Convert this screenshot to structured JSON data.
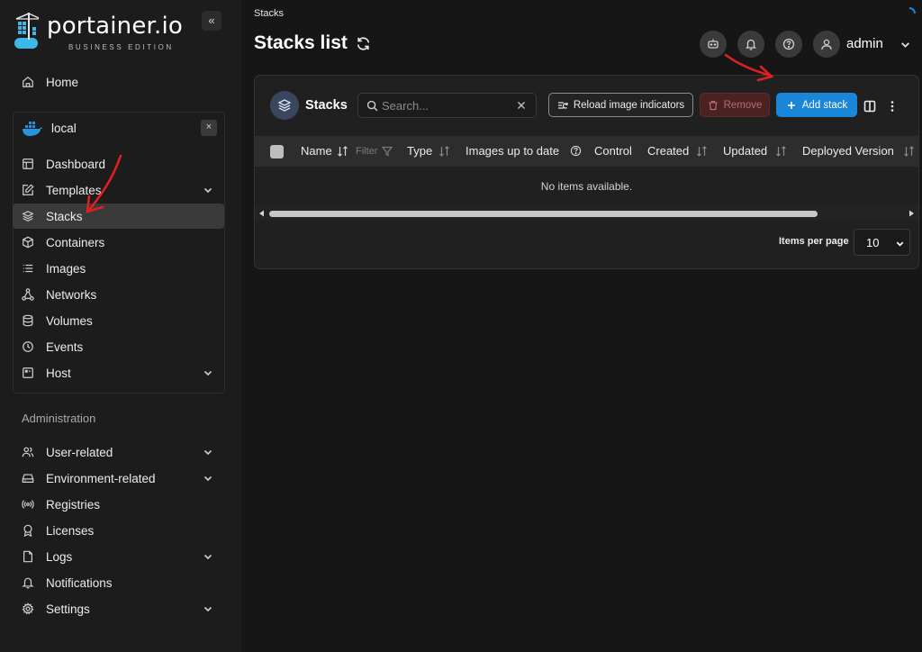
{
  "brand": {
    "name": "portainer.io",
    "edition": "BUSINESS EDITION"
  },
  "sidebar": {
    "collapse_label": "«",
    "home": "Home",
    "environment": {
      "name": "local",
      "close_label": "×"
    },
    "env_items": [
      {
        "label": "Dashboard",
        "icon": "dashboard-icon"
      },
      {
        "label": "Templates",
        "icon": "edit-icon",
        "expandable": true
      },
      {
        "label": "Stacks",
        "icon": "layers-icon",
        "active": true
      },
      {
        "label": "Containers",
        "icon": "box-icon"
      },
      {
        "label": "Images",
        "icon": "list-icon"
      },
      {
        "label": "Networks",
        "icon": "network-icon"
      },
      {
        "label": "Volumes",
        "icon": "database-icon"
      },
      {
        "label": "Events",
        "icon": "clock-icon"
      },
      {
        "label": "Host",
        "icon": "host-icon",
        "expandable": true
      }
    ],
    "admin_section_label": "Administration",
    "admin_items": [
      {
        "label": "User-related",
        "icon": "users-icon",
        "expandable": true
      },
      {
        "label": "Environment-related",
        "icon": "drive-icon",
        "expandable": true
      },
      {
        "label": "Registries",
        "icon": "broadcast-icon"
      },
      {
        "label": "Licenses",
        "icon": "award-icon"
      },
      {
        "label": "Logs",
        "icon": "file-icon",
        "expandable": true
      },
      {
        "label": "Notifications",
        "icon": "bell-icon"
      },
      {
        "label": "Settings",
        "icon": "settings-icon",
        "expandable": true
      }
    ]
  },
  "header": {
    "breadcrumb": "Stacks",
    "title": "Stacks list",
    "user": "admin"
  },
  "panel": {
    "title": "Stacks",
    "search_placeholder": "Search...",
    "reload_label": "Reload image indicators",
    "remove_label": "Remove",
    "add_label": "Add stack",
    "columns": [
      "Name",
      "Type",
      "Images up to date",
      "Control",
      "Created",
      "Updated",
      "Deployed Version"
    ],
    "filter_label": "Filter",
    "empty_message": "No items available.",
    "items_per_page_label": "Items per page",
    "items_per_page_value": "10"
  },
  "colors": {
    "accent": "#1a86d8",
    "danger": "#4b2222",
    "annotation": "#e02020"
  }
}
